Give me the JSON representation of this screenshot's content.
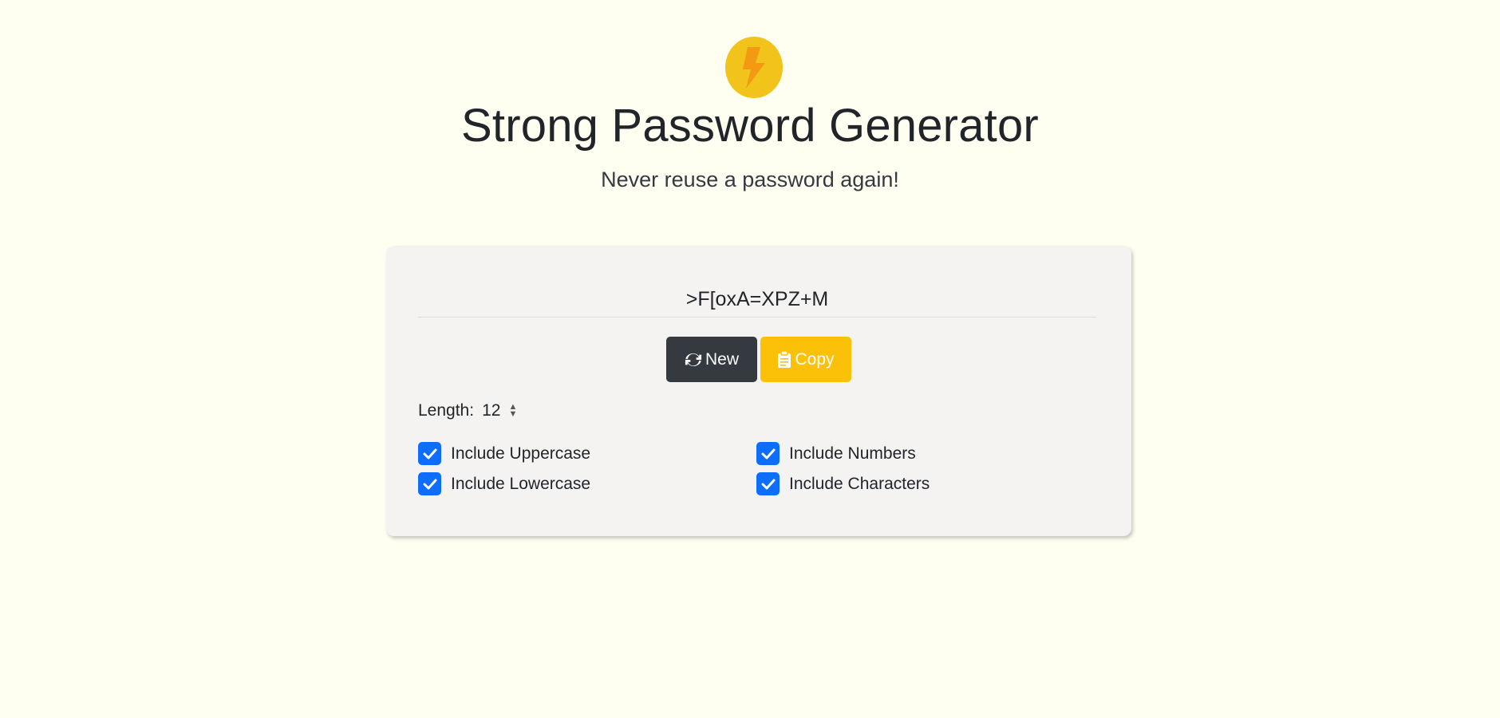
{
  "header": {
    "logo_icon": "lightning-bolt-icon",
    "title": "Strong Password Generator",
    "subtitle": "Never reuse a password again!"
  },
  "generator": {
    "password": ">F[oxA=XPZ+M",
    "new_label": "New",
    "new_icon": "refresh-icon",
    "copy_label": "Copy",
    "copy_icon": "clipboard-icon",
    "length_label": "Length:",
    "length_value": "12"
  },
  "options": [
    {
      "label": "Include Uppercase",
      "checked": true
    },
    {
      "label": "Include Numbers",
      "checked": true
    },
    {
      "label": "Include Lowercase",
      "checked": true
    },
    {
      "label": "Include Characters",
      "checked": true
    }
  ],
  "colors": {
    "background": "#fefef1",
    "card": "#f5f3f2",
    "new_button": "#353a40",
    "copy_button": "#fbc108",
    "checkbox": "#0d6efd",
    "logo": "#f2c31a"
  }
}
